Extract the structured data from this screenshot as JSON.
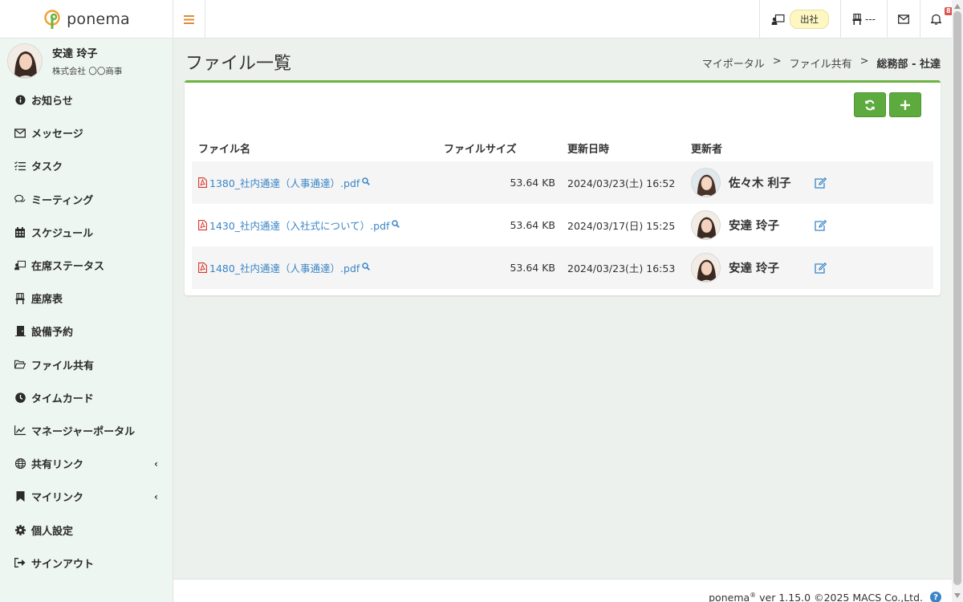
{
  "app": {
    "logo_text": "ponema"
  },
  "user": {
    "name": "安達 玲子",
    "company": "株式会社 〇〇商事"
  },
  "sidebar": {
    "items": [
      {
        "label": "お知らせ",
        "icon": "info-circle-icon"
      },
      {
        "label": "メッセージ",
        "icon": "envelope-icon"
      },
      {
        "label": "タスク",
        "icon": "checklist-icon"
      },
      {
        "label": "ミーティング",
        "icon": "chat-bubbles-icon"
      },
      {
        "label": "スケジュール",
        "icon": "calendar-icon"
      },
      {
        "label": "在席ステータス",
        "icon": "presence-icon"
      },
      {
        "label": "座席表",
        "icon": "chair-icon"
      },
      {
        "label": "設備予約",
        "icon": "door-icon"
      },
      {
        "label": "ファイル共有",
        "icon": "folder-open-icon"
      },
      {
        "label": "タイムカード",
        "icon": "clock-icon"
      },
      {
        "label": "マネージャーポータル",
        "icon": "line-chart-icon"
      },
      {
        "label": "共有リンク",
        "icon": "globe-icon",
        "arrow": "‹"
      },
      {
        "label": "マイリンク",
        "icon": "bookmark-icon",
        "arrow": "‹"
      },
      {
        "label": "個人設定",
        "icon": "gear-icon"
      },
      {
        "label": "サインアウト",
        "icon": "sign-out-icon"
      }
    ]
  },
  "topbar": {
    "attendance_label": "出社",
    "seat_value": "---",
    "notification_count": "8"
  },
  "page": {
    "title": "ファイル一覧",
    "breadcrumb": [
      "マイポータル",
      "ファイル共有",
      "総務部 - 社達"
    ],
    "breadcrumb_sep": ">"
  },
  "table": {
    "headers": {
      "name": "ファイル名",
      "size": "ファイルサイズ",
      "date": "更新日時",
      "updater": "更新者"
    },
    "rows": [
      {
        "name": "1380_社内通達（人事通達）.pdf",
        "size": "53.64 KB",
        "date": "2024/03/23(土) 16:52",
        "updater": "佐々木 利子"
      },
      {
        "name": "1430_社内通達（入社式について）.pdf",
        "size": "53.64 KB",
        "date": "2024/03/17(日) 15:25",
        "updater": "安達 玲子"
      },
      {
        "name": "1480_社内通達（人事通達）.pdf",
        "size": "53.64 KB",
        "date": "2024/03/23(土) 16:53",
        "updater": "安達 玲子"
      }
    ]
  },
  "footer": {
    "brand": "ponema",
    "reg": "®",
    "version_text": " ver 1.15.0 ©2025 MACS Co.,Ltd."
  },
  "colors": {
    "accent_green": "#5daa3e",
    "link_blue": "#3a85c6",
    "menu_orange": "#e08b3a",
    "sidebar_bg": "#eef6f1"
  }
}
